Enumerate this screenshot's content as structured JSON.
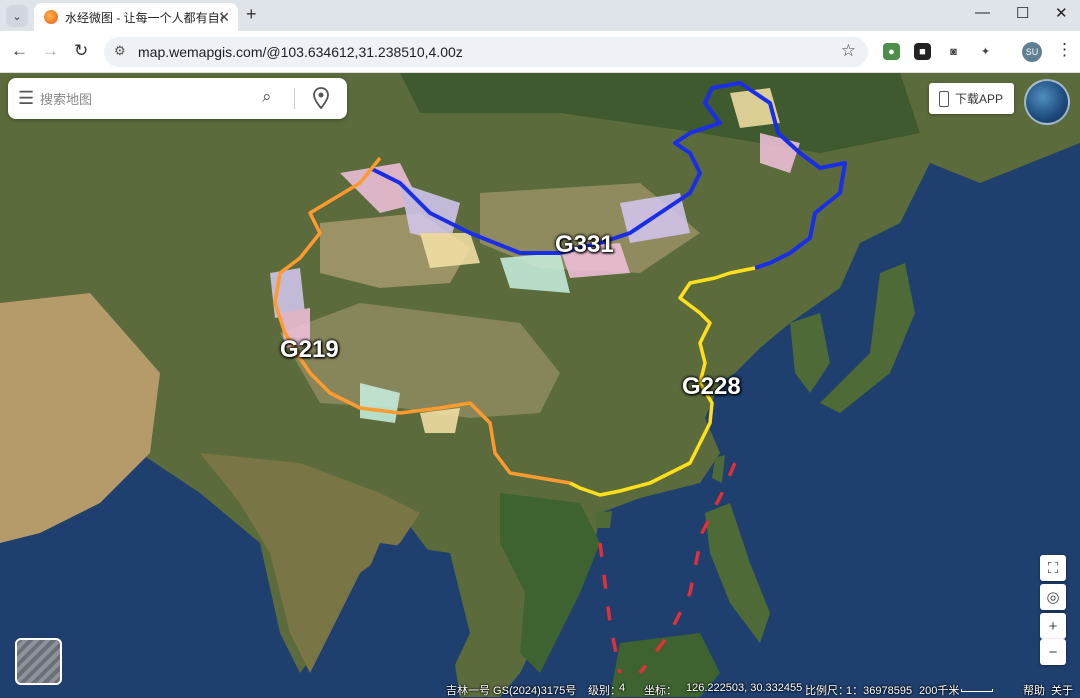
{
  "browser": {
    "tab_title": "水经微图 - 让每一个人都有自己的地图",
    "url": "map.wemapgis.com/@103.634612,31.238510,4.00z",
    "avatar_text": "SU"
  },
  "search": {
    "placeholder": "搜索地图"
  },
  "download_app": "下载APP",
  "map_labels": {
    "g331": "G331",
    "g219": "G219",
    "g228": "G228"
  },
  "route_colors": {
    "g331": "#1a2ee8",
    "g219": "#ff9a2e",
    "g228": "#ffe01a",
    "nine_dash": "#e0303a"
  },
  "zoom_controls": {
    "plus": "+",
    "minus": "−"
  },
  "status": {
    "source": "吉林一号 GS(2024)3175号",
    "level_label": "级别：",
    "level_value": "4",
    "coords_label": "坐标：",
    "coords_value": "126.222503, 30.332455",
    "scale_label": "比例尺：",
    "scale_value": "1：36978595",
    "scale_bar": "200千米",
    "help": "帮助",
    "about": "关于"
  }
}
